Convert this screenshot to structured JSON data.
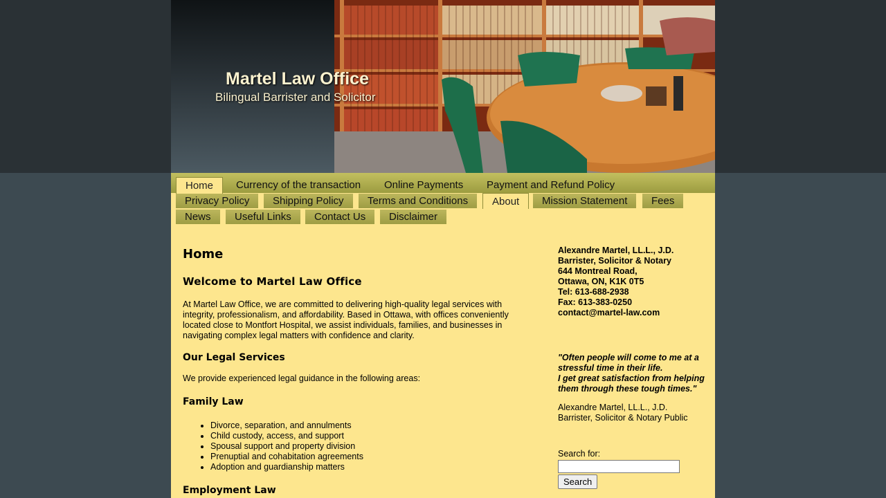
{
  "header": {
    "title": "Martel Law Office",
    "subtitle": "Bilingual Barrister and Solicitor"
  },
  "nav": {
    "row1": [
      "Home",
      "Currency of the transaction",
      "Online Payments",
      "Payment and Refund Policy"
    ],
    "row2": [
      "Privacy Policy",
      "Shipping Policy",
      "Terms and Conditions",
      "About",
      "Mission Statement",
      "Fees"
    ],
    "row3": [
      "News",
      "Useful Links",
      "Contact Us",
      "Disclaimer"
    ]
  },
  "content": {
    "page_title": "Home",
    "welcome_heading": "Welcome to Martel Law Office",
    "intro": "At Martel Law Office, we are committed to delivering high-quality legal services with integrity, professionalism, and affordability. Based in Ottawa, with offices conveniently located close to Montfort Hospital, we assist individuals, families, and businesses in navigating complex legal matters with confidence and clarity.",
    "services_heading": "Our Legal Services",
    "services_intro": "We provide experienced legal guidance in the following areas:",
    "family_heading": "Family Law",
    "family_items": [
      "Divorce, separation, and annulments",
      "Child custody, access, and support",
      "Spousal support and property division",
      "Prenuptial and cohabitation agreements",
      "Adoption and guardianship matters"
    ],
    "employment_heading": "Employment Law"
  },
  "sidebar": {
    "contact": [
      "Alexandre Martel, LL.L., J.D.",
      "Barrister, Solicitor & Notary",
      "644 Montreal Road,",
      "Ottawa, ON, K1K 0T5",
      "Tel: 613-688-2938",
      "Fax: 613-383-0250",
      "contact@martel-law.com"
    ],
    "quote_lines": [
      "\"Often people will come to me at a stressful time in their life.",
      "I get great satisfaction from helping them through these tough times.\""
    ],
    "sig_name": "Alexandre Martel, LL.L., J.D.",
    "sig_title": "Barrister, Solicitor & Notary Public",
    "search_label": "Search for:",
    "search_value": "",
    "search_button": "Search"
  },
  "colors": {
    "page_background": "#fde68e",
    "nav_tab": "#a8a64a",
    "body_background": "#3d4a51"
  }
}
